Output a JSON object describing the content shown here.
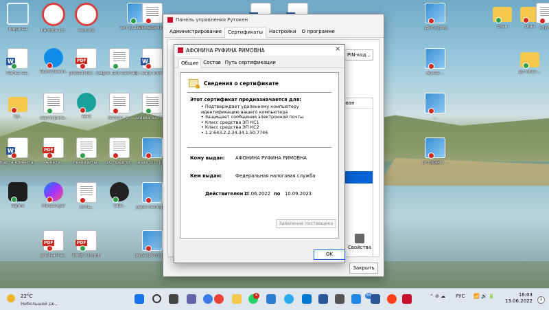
{
  "desktop_icons": [
    {
      "label": "Корзина",
      "kind": "recycle"
    },
    {
      "label": "Remote Ut..",
      "kind": "remote"
    },
    {
      "label": "Remote",
      "kind": "remote"
    },
    {
      "label": "зап удален ..jpeg",
      "kind": "img"
    },
    {
      "label": "Бланк заявл..",
      "kind": "doc"
    },
    {
      "label": "Бланк запроса..",
      "kind": "word"
    },
    {
      "label": "Бланк заявления",
      "kind": "word"
    },
    {
      "label": "скан",
      "kind": "folder"
    },
    {
      "label": "ключ..",
      "kind": "doc"
    },
    {
      "label": "Папка на..",
      "kind": "word"
    },
    {
      "label": "TeamViewer..",
      "kind": "teamviewer"
    },
    {
      "label": "predvaritel.. (1).pdf",
      "kind": "pdf"
    },
    {
      "label": "фон для сайта2.docx",
      "kind": "doc"
    },
    {
      "label": "ос карр клиент..docx",
      "kind": "word"
    },
    {
      "label": "Ср..",
      "kind": "folder"
    },
    {
      "label": "сертифика..",
      "kind": "doc"
    },
    {
      "label": "eset",
      "kind": "eset"
    },
    {
      "label": "Запрос_р..",
      "kind": "doc"
    },
    {
      "label": "Заявка на отпуск..",
      "kind": "doc"
    },
    {
      "label": "Карта клиента..",
      "kind": "word"
    },
    {
      "label": "Анкета..",
      "kind": "pdf"
    },
    {
      "label": "Реквизиты..",
      "kind": "doc"
    },
    {
      "label": "1С предпр..",
      "kind": "doc"
    },
    {
      "label": "агент 1С..jpeg",
      "kind": "img"
    },
    {
      "label": "Figma",
      "kind": "figma"
    },
    {
      "label": "Messenger",
      "kind": "messenger"
    },
    {
      "label": "Акты..",
      "kind": "doc"
    },
    {
      "label": "OBS..",
      "kind": "obs"
    },
    {
      "label": "руба паспорт..",
      "kind": "img"
    },
    {
      "label": "predvaritel..",
      "kind": "pdf"
    },
    {
      "label": "ИФНС 15.pdf",
      "kind": "pdf"
    },
    {
      "label": "руба фото.jpeg",
      "kind": "img"
    },
    {
      "label": "..фото.jpeg",
      "kind": "img"
    },
    {
      "label": "скан",
      "kind": "folder"
    },
    {
      "label": "Архив ..",
      "kind": "img"
    },
    {
      "label": "..",
      "kind": "img"
    },
    {
      "label": "рутокен ..",
      "kind": "folder"
    },
    {
      "label": "рутокен 1 ..",
      "kind": "img"
    },
    {
      "label": "..jpeg",
      "kind": "img"
    }
  ],
  "main_window": {
    "title": "Панель управления Рутокен",
    "tabs": [
      "Администрирование",
      "Сертификаты",
      "Настройки",
      "О программе"
    ],
    "active_tab": "Сертификаты",
    "pin_button": "PIN-код...",
    "list_column": "рован",
    "properties_label": "Свойства",
    "close_button": "Закрыть"
  },
  "cert_dialog": {
    "title": "АФОНИНА РУФИНА РИМОВНА",
    "tabs": [
      "Общие",
      "Состав",
      "Путь сертификации"
    ],
    "active_tab": "Общие",
    "header": "Сведения о сертификате",
    "purpose_heading": "Этот сертификат предназначается для:",
    "purposes": [
      "Подтверждает удаленному компьютеру идентификацию вашего компьютера",
      "Защищает сообщения электронной почты",
      "Класс средства ЭП КС1",
      "Класс средства ЭП КС2",
      "1.2.643.2.2.34.34.1.50.7746"
    ],
    "issued_to_label": "Кому выдан:",
    "issued_to": "АФОНИНА РУФИНА РИМОВНА",
    "issued_by_label": "Кем выдан:",
    "issued_by": "Федеральная налоговая служба",
    "valid_from_label": "Действителен с",
    "valid_from": "10.06.2022",
    "valid_to_label": "по",
    "valid_to": "10.09.2023",
    "issuer_statement_button": "Заявление поставщика",
    "ok_button": "OK"
  },
  "taskbar": {
    "temperature": "22°C",
    "weather_text": "Небольшой до...",
    "language": "РУС",
    "time": "16:03",
    "date": "13.06.2022",
    "badges": {
      "whatsapp": "4",
      "browser": "69"
    }
  }
}
